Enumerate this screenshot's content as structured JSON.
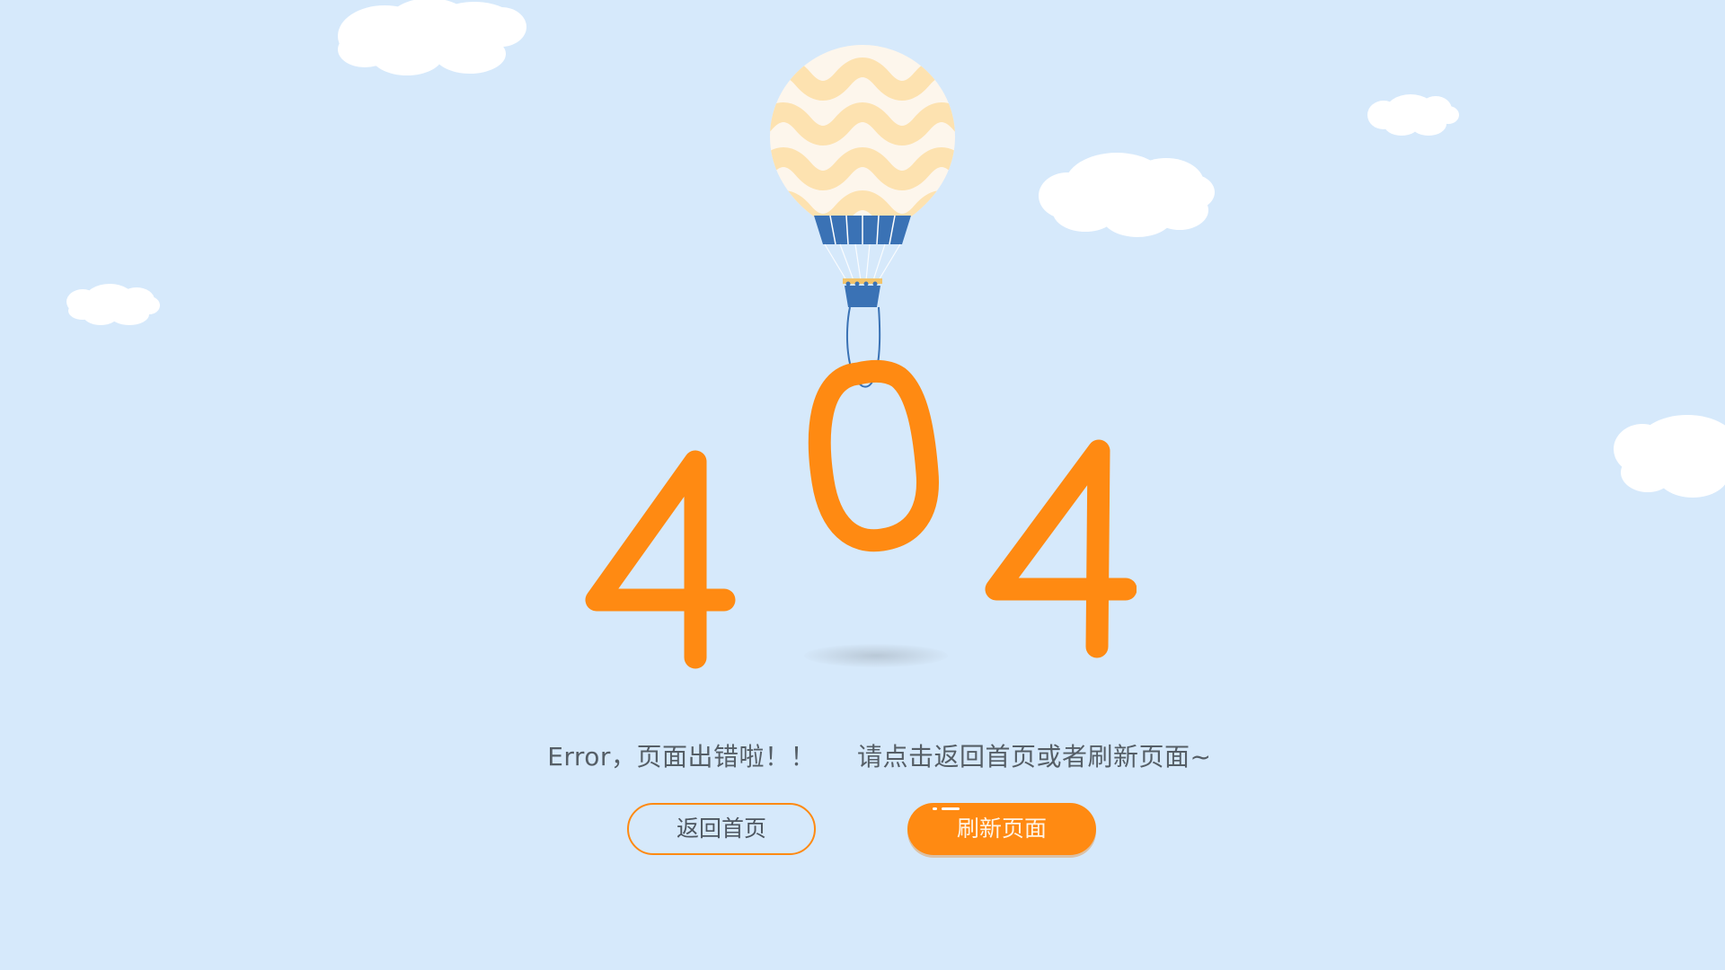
{
  "page": {
    "error_code_digits": [
      "4",
      "0",
      "4"
    ],
    "message_left": "Error，页面出错啦！！",
    "message_right": "请点击返回首页或者刷新页面~"
  },
  "actions": {
    "home_label": "返回首页",
    "refresh_label": "刷新页面"
  },
  "colors": {
    "background": "#d6e9fb",
    "accent_orange": "#ff8a12",
    "balloon_stripe": "#fde2b0",
    "balloon_base": "#fdf6ec",
    "basket_blue": "#3a72b5",
    "cloud": "#ffffff",
    "text": "#555e66"
  },
  "icons": {
    "balloon": "hot-air-balloon-illustration",
    "clouds": "cloud-icon"
  }
}
